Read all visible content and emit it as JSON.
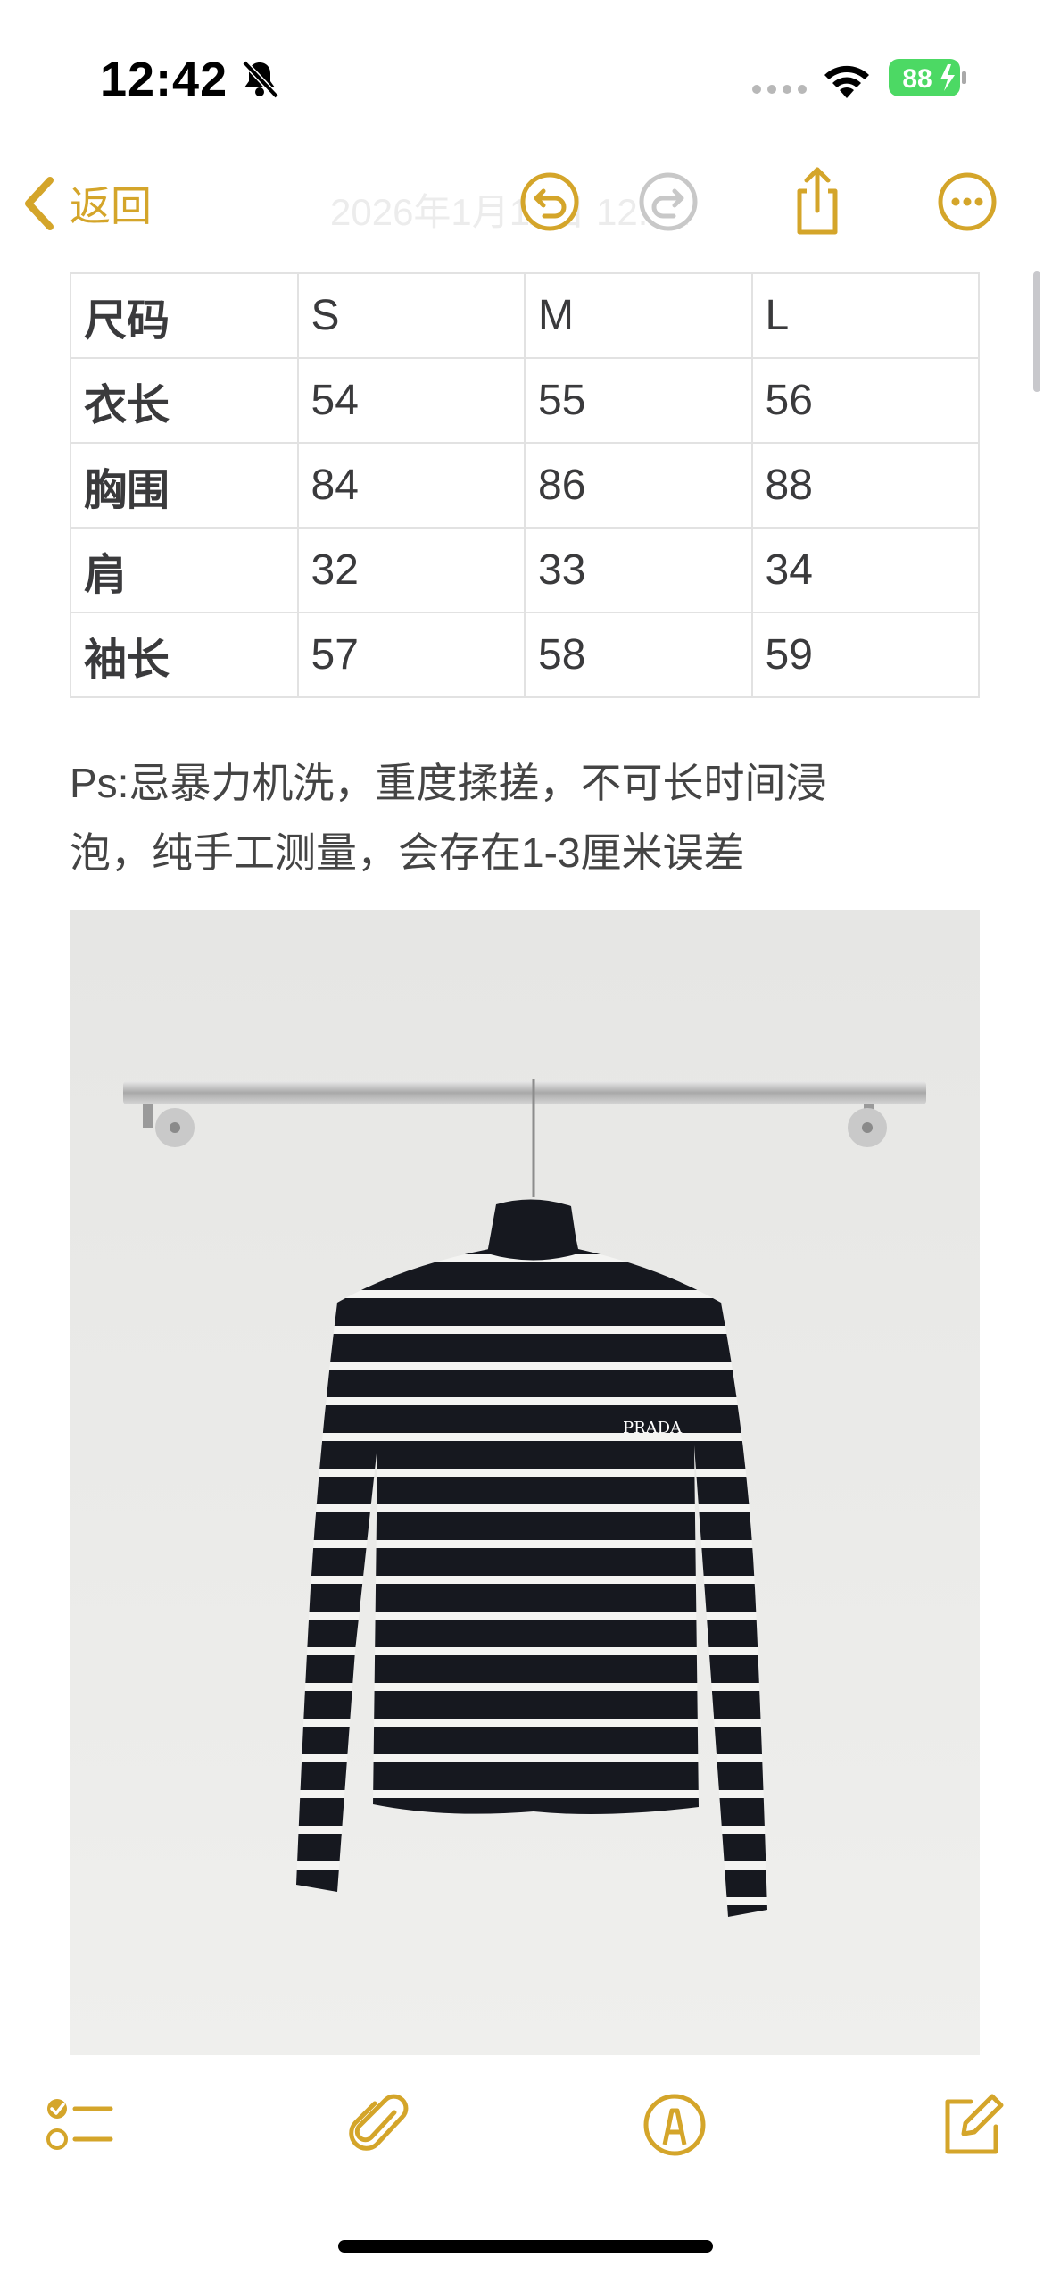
{
  "status": {
    "time": "12:42",
    "battery": "88"
  },
  "nav": {
    "back_label": "返回",
    "title": "2026年1月11日 12:42"
  },
  "table": {
    "rows": [
      [
        "尺码",
        "S",
        "M",
        "L"
      ],
      [
        "衣长",
        "54",
        "55",
        "56"
      ],
      [
        "胸围",
        "84",
        "86",
        "88"
      ],
      [
        "肩",
        "32",
        "33",
        "34"
      ],
      [
        "袖长",
        "57",
        "58",
        "59"
      ]
    ]
  },
  "note": {
    "line1": "Ps:忌暴力机洗，重度揉搓，不可长时间浸",
    "line2": "泡，纯手工测量，会存在1-3厘米误差"
  },
  "photo": {
    "logo_text": "PRADA"
  },
  "colors": {
    "accent": "#d4a52a",
    "battery_green": "#4cd964"
  }
}
